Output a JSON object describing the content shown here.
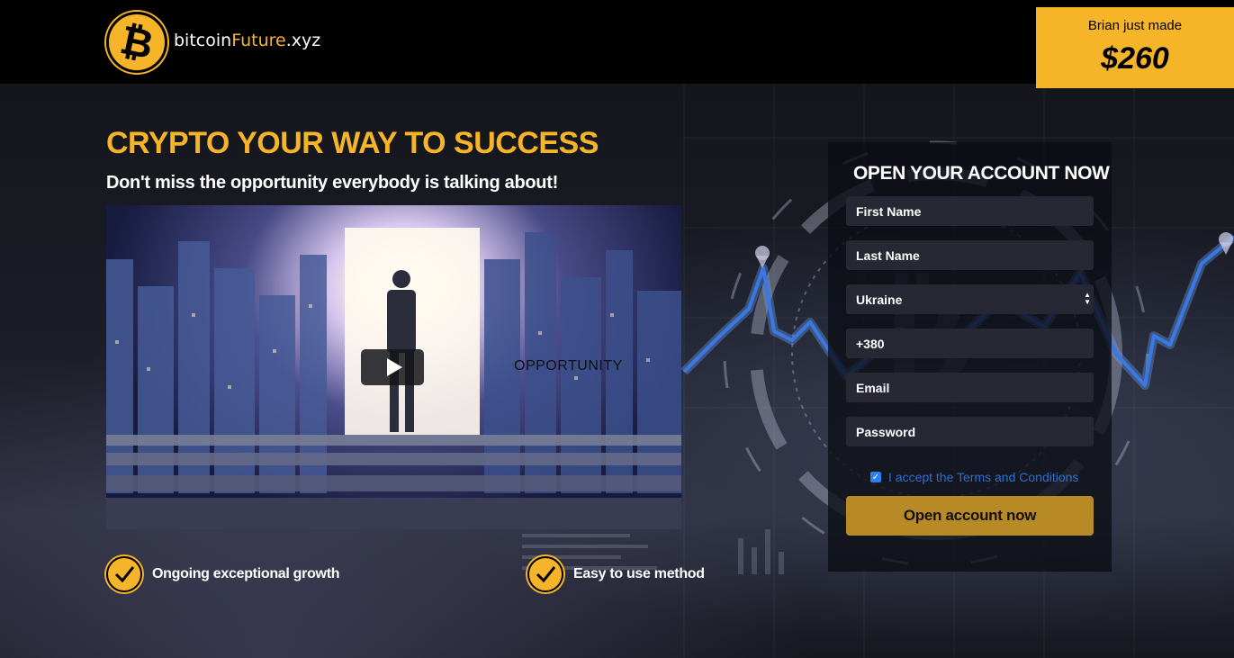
{
  "colors": {
    "accent": "#f6b528",
    "button": "#b78a26",
    "link": "#2d6fd0",
    "field_bg": "#272833"
  },
  "header": {
    "logo_icon": "bitcoin-icon",
    "logo_symbol": "₿",
    "brand_part1": "bitcoin",
    "brand_part2": "Future",
    "brand_part3": ".xyz"
  },
  "notice": {
    "text": "Brian just made",
    "amount": "$260"
  },
  "hero": {
    "headline": "CRYPTO YOUR WAY TO SUCCESS",
    "subhead": "Don't miss the opportunity everybody is talking about!"
  },
  "video": {
    "label": "OPPORTUNITY",
    "play_icon": "play-icon"
  },
  "features": [
    {
      "icon": "check-icon",
      "label": "Ongoing exceptional growth"
    },
    {
      "icon": "check-icon",
      "label": "Easy to use method"
    }
  ],
  "form": {
    "title": "OPEN YOUR ACCOUNT NOW",
    "first_name_placeholder": "First Name",
    "last_name_placeholder": "Last Name",
    "country_value": "Ukraine",
    "phone_value": "+380",
    "email_placeholder": "Email",
    "password_placeholder": "Password",
    "terms_checked": true,
    "terms_label": "I accept the Terms and Conditions",
    "submit_label": "Open account now"
  }
}
